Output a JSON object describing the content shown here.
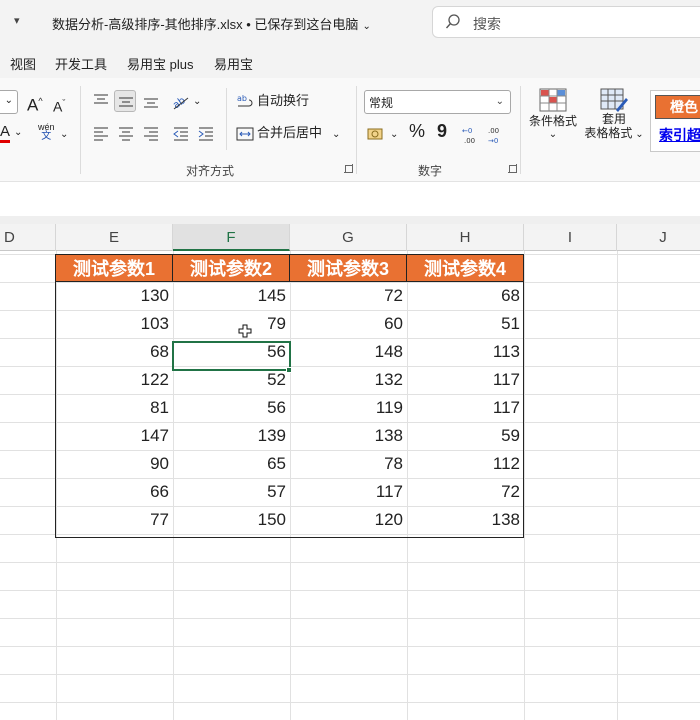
{
  "titlebar": {
    "qa_dropdown": "▾",
    "doc_title": "数据分析-高级排序-其他排序.xlsx • 已保存到这台电脑",
    "title_chevron": "⌄",
    "search_placeholder": "搜索"
  },
  "menu": [
    "视图",
    "开发工具",
    "易用宝 plus",
    "易用宝"
  ],
  "ribbon": {
    "font_grow": "A",
    "font_shrink": "A",
    "font_color_letter": "A",
    "phonetic_top": "wén",
    "phonetic_bottom": "文",
    "wrap_text": "自动换行",
    "merge_center": "合并后居中",
    "align_group_label": "对齐方式",
    "number_format_value": "常规",
    "percent": "%",
    "comma": "9",
    "number_group_label": "数字",
    "conditional_format": "条件格式",
    "table_format_line1": "套用",
    "table_format_line2": "表格格式",
    "style_orange": "橙色",
    "style_link": "索引超"
  },
  "sheet": {
    "columns": [
      "D",
      "E",
      "F",
      "G",
      "H",
      "I",
      "J"
    ],
    "selected_column": "F",
    "headers": [
      "测试参数1",
      "测试参数2",
      "测试参数3",
      "测试参数4"
    ],
    "rows": [
      [
        "130",
        "145",
        "72",
        "68"
      ],
      [
        "103",
        "79",
        "60",
        "51"
      ],
      [
        "68",
        "56",
        "148",
        "113"
      ],
      [
        "122",
        "52",
        "132",
        "117"
      ],
      [
        "81",
        "56",
        "119",
        "117"
      ],
      [
        "147",
        "139",
        "138",
        "59"
      ],
      [
        "90",
        "65",
        "78",
        "112"
      ],
      [
        "66",
        "57",
        "117",
        "72"
      ],
      [
        "77",
        "150",
        "120",
        "138"
      ]
    ],
    "active_cell": "F4",
    "header_color": "#e97132",
    "accent_green": "#217346"
  }
}
